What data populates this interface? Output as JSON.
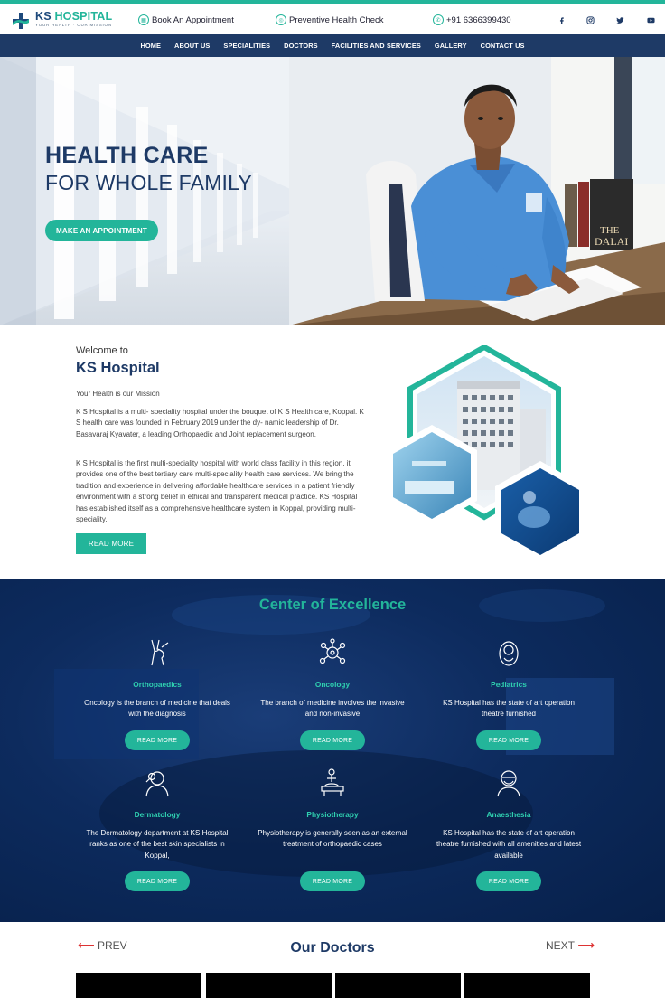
{
  "brand": {
    "name_main": "KS",
    "name_accent": "HOSPITAL",
    "tagline": "YOUR HEALTH · OUR MISSION"
  },
  "topbar": {
    "appointment": "Book An Appointment",
    "health_check": "Preventive Health Check",
    "phone": "+91 6366399430",
    "social_icons": [
      "facebook-icon",
      "instagram-icon",
      "twitter-icon",
      "youtube-icon"
    ]
  },
  "nav": {
    "items": [
      "HOME",
      "ABOUT US",
      "SPECIALITIES",
      "DOCTORS",
      "FACILITIES AND SERVICES",
      "GALLERY",
      "CONTACT US"
    ]
  },
  "hero": {
    "line1": "HEALTH CARE",
    "line2": "FOR WHOLE FAMILY",
    "cta": "MAKE AN APPOINTMENT"
  },
  "welcome": {
    "pre": "Welcome to",
    "title": "KS Hospital",
    "mission": "Your Health is our Mission",
    "p1": "K S Hospital is a multi- speciality hospital under the bouquet of K S Health care, Koppal. K S health care was founded in February 2019 under the dy- namic leadership of Dr. Basavaraj Kyavater, a leading Orthopaedic and Joint replacement surgeon.",
    "p2": "K S Hospital is the first multi-speciality hospital with world class facility in this region, it provides one of the best tertiary care multi-speciality health care services. We bring the tradition and experience in delivering affordable healthcare services in a patient friendly environment with a strong belief in ethical and transparent medical practice. KS Hospital has established itself as a comprehensive healthcare system in Koppal, providing multi- speciality.",
    "button": "READ MORE"
  },
  "coe": {
    "title": "Center of Excellence",
    "cards": [
      {
        "name": "Orthopaedics",
        "desc": "Oncology is the branch of medicine that deals with the diagnosis",
        "button": "READ MORE",
        "icon": "knee-joint-icon"
      },
      {
        "name": "Oncology",
        "desc": "The branch of medicine involves the invasive and non-invasive",
        "button": "READ MORE",
        "icon": "cell-icon"
      },
      {
        "name": "Pediatrics",
        "desc": "KS Hospital has the state of art operation theatre furnished",
        "button": "READ MORE",
        "icon": "baby-icon"
      },
      {
        "name": "Dermatology",
        "desc": "The Dermatology department at KS Hospital ranks as one of the best skin specialists in Koppal,",
        "button": "READ MORE",
        "icon": "skin-exam-icon"
      },
      {
        "name": "Physiotherapy",
        "desc": "Physiotherapy is generally seen as an external treatment of orthopaedic cases",
        "button": "READ MORE",
        "icon": "physio-icon"
      },
      {
        "name": "Anaesthesia",
        "desc": "KS Hospital has the state of art operation theatre furnished with all amenities and latest available",
        "button": "READ MORE",
        "icon": "anaesthesia-mask-icon"
      }
    ]
  },
  "doctors": {
    "prev": "PREV",
    "next": "NEXT",
    "title": "Our Doctors"
  },
  "colors": {
    "teal": "#23b59a",
    "navy": "#1e3a66",
    "dark_blue": "#0d2b5e"
  }
}
